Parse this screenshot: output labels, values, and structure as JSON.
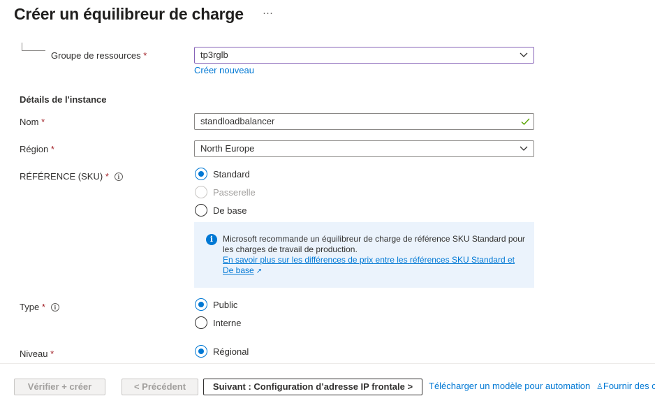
{
  "header": {
    "title": "Créer un équilibreur de charge",
    "more": "···"
  },
  "resource_group": {
    "label": "Groupe de ressources",
    "required": "*",
    "value": "tp3rglb",
    "create_link": "Créer nouveau"
  },
  "instance": {
    "section_title": "Détails de l'instance",
    "name": {
      "label": "Nom",
      "required": "*",
      "value": "standloadbalancer"
    },
    "region": {
      "label": "Région",
      "required": "*",
      "value": "North Europe"
    },
    "sku": {
      "label": "RÉFÉRENCE (SKU)",
      "required": "*",
      "options": [
        {
          "label": "Standard",
          "checked": true,
          "disabled": false
        },
        {
          "label": "Passerelle",
          "checked": false,
          "disabled": true
        },
        {
          "label": "De base",
          "checked": false,
          "disabled": false
        }
      ],
      "info_text": "Microsoft recommande un équilibreur de charge de référence SKU Standard pour les charges de travail de production.",
      "info_link": "En savoir plus sur les différences de prix entre les références SKU Standard et De base"
    },
    "type": {
      "label": "Type",
      "required": "*",
      "options": [
        {
          "label": "Public",
          "checked": true
        },
        {
          "label": "Interne",
          "checked": false
        }
      ]
    },
    "tier": {
      "label": "Niveau",
      "required": "*",
      "options": [
        {
          "label": "Régional",
          "checked": true
        }
      ]
    }
  },
  "footer": {
    "review_create": "Vérifier + créer",
    "previous": "< Précédent",
    "next": "Suivant : Configuration d’adresse IP frontale >",
    "download_template": "Télécharger un modèle pour automation",
    "feedback": "Fournir des c"
  },
  "colors": {
    "accent": "#0078d4",
    "required": "#a4262c",
    "valid": "#57a300",
    "active_border": "#8764b8",
    "info_bg": "#ebf3fc"
  }
}
